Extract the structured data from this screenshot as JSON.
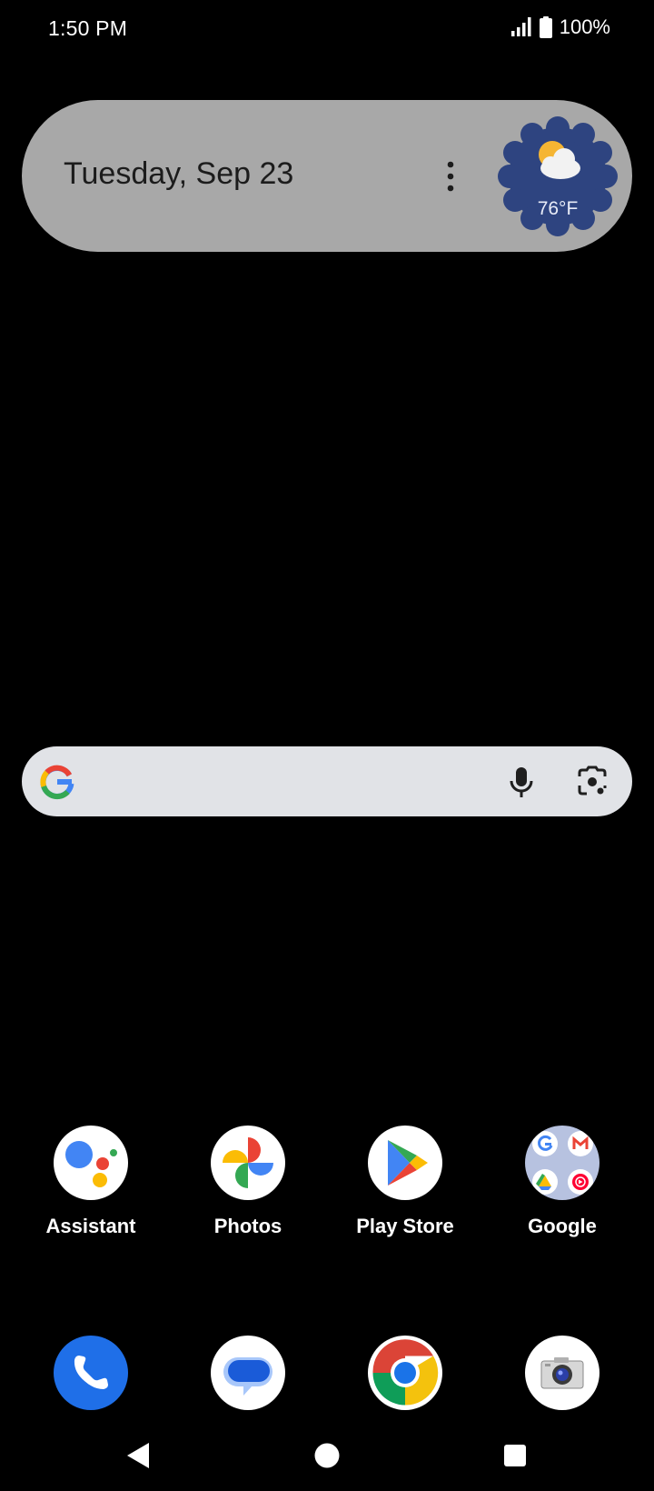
{
  "status_bar": {
    "time": "1:50 PM",
    "battery": "100%",
    "icons": [
      "cell-signal-icon",
      "battery-icon"
    ]
  },
  "date_widget": {
    "date": "Tuesday, Sep 23",
    "temperature": "76°F",
    "weather_icon": "partly-cloudy-icon"
  },
  "search_bar": {
    "icons": [
      "google-g-icon",
      "microphone-icon",
      "google-lens-icon"
    ]
  },
  "home_apps": [
    {
      "label": "Assistant",
      "icon": "assistant-icon"
    },
    {
      "label": "Photos",
      "icon": "photos-pinwheel-icon"
    },
    {
      "label": "Play Store",
      "icon": "play-store-icon"
    },
    {
      "label": "Google",
      "icon": "folder-icon"
    }
  ],
  "dock": [
    {
      "icon": "phone-icon"
    },
    {
      "icon": "messages-icon"
    },
    {
      "icon": "chrome-icon"
    },
    {
      "icon": "camera-icon"
    }
  ],
  "nav": [
    "back-icon",
    "home-icon",
    "recents-icon"
  ],
  "colors": {
    "background": "#000000",
    "widget": "#a8a8a8",
    "weather_badge": "#2e4480",
    "search_bar": "#e1e3e7",
    "phone_blue": "#1f6fe8"
  }
}
